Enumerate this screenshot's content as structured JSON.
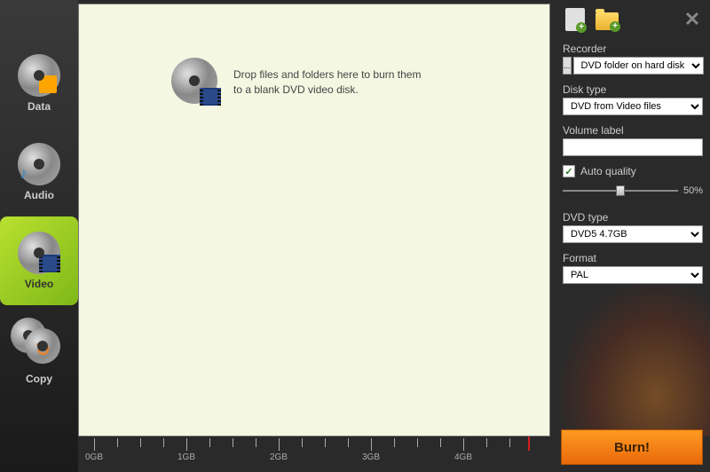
{
  "sidebar": {
    "items": [
      {
        "label": "Data"
      },
      {
        "label": "Audio"
      },
      {
        "label": "Video"
      },
      {
        "label": "Copy"
      }
    ]
  },
  "main": {
    "drop_line1": "Drop files and folders here to burn them",
    "drop_line2": "to a blank DVD video disk."
  },
  "ruler": {
    "labels": [
      "0GB",
      "1GB",
      "2GB",
      "3GB",
      "4GB"
    ],
    "marker_gb": 4.7
  },
  "panel": {
    "recorder": {
      "label": "Recorder",
      "value": "DVD folder on hard disk",
      "browse": "..."
    },
    "disktype": {
      "label": "Disk type",
      "value": "DVD from Video files"
    },
    "volume": {
      "label": "Volume label",
      "value": ""
    },
    "quality": {
      "label": "Auto quality",
      "checked": true,
      "slider_pct": 50,
      "slider_text": "50%"
    },
    "dvdtype": {
      "label": "DVD type",
      "value": "DVD5 4.7GB"
    },
    "format": {
      "label": "Format",
      "value": "PAL"
    }
  },
  "burn": {
    "label": "Burn!"
  }
}
